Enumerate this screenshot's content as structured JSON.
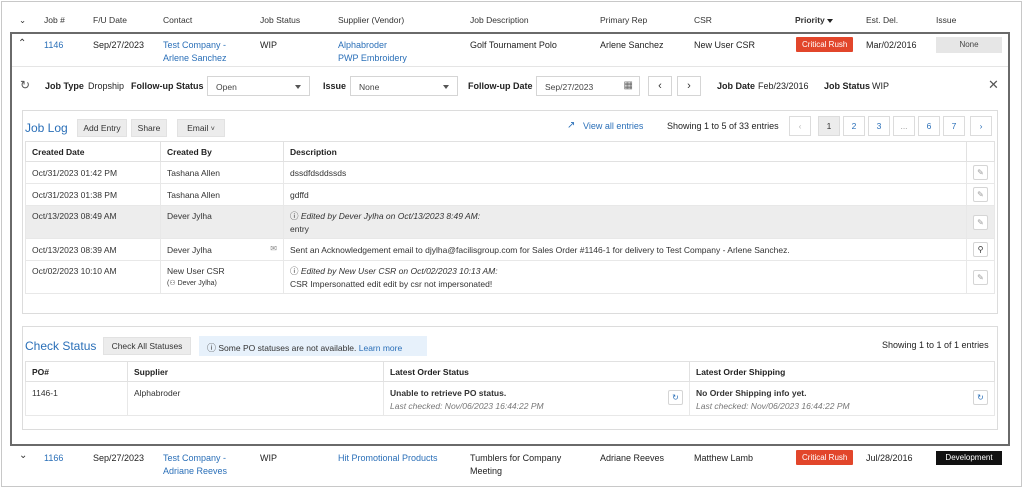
{
  "colors": {
    "accent": "#2a6fb8",
    "critical": "#e2462b",
    "development": "#111111"
  },
  "columns": [
    "Job #",
    "F/U Date",
    "Contact",
    "Job Status",
    "Supplier (Vendor)",
    "Job Description",
    "Primary Rep",
    "CSR",
    "Priority",
    "Est. Del.",
    "Issue"
  ],
  "jobs": [
    {
      "num": "1146",
      "fu_date": "Sep/27/2023",
      "contact_line1": "Test Company -",
      "contact_line2": "Arlene Sanchez",
      "status": "WIP",
      "supplier_line1": "Alphabroder",
      "supplier_line2": "PWP Embroidery",
      "description_line1": "Golf Tournament Polo",
      "description_line2": "",
      "rep": "Arlene Sanchez",
      "csr": "New User CSR",
      "priority": "Critical Rush",
      "est_del": "Mar/02/2016",
      "issue": "None"
    },
    {
      "num": "1166",
      "fu_date": "Sep/27/2023",
      "contact_line1": "Test Company -",
      "contact_line2": "Adriane Reeves",
      "status": "WIP",
      "supplier_line1": "Hit Promotional Products",
      "supplier_line2": "",
      "description_line1": "Tumblers for Company",
      "description_line2": "Meeting",
      "rep": "Adriane Reeves",
      "csr": "Matthew Lamb",
      "priority": "Critical Rush",
      "est_del": "Jul/28/2016",
      "issue": "Development"
    }
  ],
  "detail": {
    "job_type_label": "Job Type",
    "job_type_value": "Dropship",
    "followup_status_label": "Follow-up Status",
    "followup_status_value": "Open",
    "issue_label": "Issue",
    "issue_value": "None",
    "followup_date_label": "Follow-up Date",
    "followup_date_value": "Sep/27/2023",
    "job_date_label": "Job Date",
    "job_date_value": "Feb/23/2016",
    "job_status_label": "Job Status",
    "job_status_value": "WIP"
  },
  "job_log": {
    "title": "Job Log",
    "add_entry": "Add Entry",
    "share": "Share",
    "email": "Email",
    "view_all": "View all entries",
    "showing": "Showing 1 to 5 of 33 entries",
    "pages": [
      "1",
      "2",
      "3",
      "...",
      "6",
      "7"
    ],
    "columns": [
      "Created Date",
      "Created By",
      "Description"
    ],
    "rows": [
      {
        "date": "Oct/31/2023 01:42 PM",
        "by": "Tashana Allen",
        "by_sub": "",
        "edited": "",
        "desc": "dssdfdsddssds"
      },
      {
        "date": "Oct/31/2023 01:38 PM",
        "by": "Tashana Allen",
        "by_sub": "",
        "edited": "",
        "desc": "gdffd"
      },
      {
        "date": "Oct/13/2023 08:49 AM",
        "by": "Dever Jylha",
        "by_sub": "",
        "edited": "Edited by Dever Jylha on Oct/13/2023 8:49 AM:",
        "desc": "entry"
      },
      {
        "date": "Oct/13/2023 08:39 AM",
        "by": "Dever Jylha",
        "by_sub": "",
        "edited": "",
        "desc": "Sent an Acknowledgement email to djylha@facilisgroup.com for Sales Order #1146-1 for delivery to Test Company - Arlene Sanchez."
      },
      {
        "date": "Oct/02/2023 10:10 AM",
        "by": "New User CSR",
        "by_sub": "Dever Jylha",
        "edited": "Edited by New User CSR on Oct/02/2023 10:13 AM:",
        "desc": "CSR Impersonatted edit edit by csr not impersonated!"
      }
    ]
  },
  "check_status": {
    "title": "Check Status",
    "check_all": "Check All Statuses",
    "notice": "Some PO statuses are not available.",
    "learn_more": "Learn more",
    "showing": "Showing 1 to 1 of 1 entries",
    "columns": [
      "PO#",
      "Supplier",
      "Latest Order Status",
      "Latest Order Shipping"
    ],
    "row": {
      "po": "1146-1",
      "supplier": "Alphabroder",
      "status": "Unable to retrieve PO status.",
      "status_checked": "Last checked: Nov/06/2023 16:44:22 PM",
      "shipping": "No Order Shipping info yet.",
      "shipping_checked": "Last checked: Nov/06/2023 16:44:22 PM"
    }
  }
}
